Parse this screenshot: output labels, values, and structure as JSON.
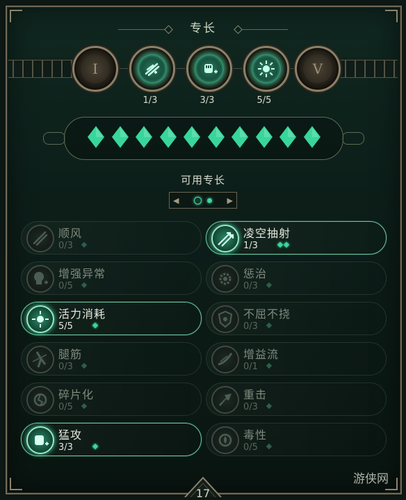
{
  "header": {
    "title": "专长"
  },
  "tiers": [
    {
      "id": "I",
      "label": "I",
      "locked": true,
      "icon": "locked-tier-icon",
      "count": ""
    },
    {
      "id": "II",
      "label": "",
      "locked": false,
      "icon": "wind-feathers-icon",
      "count": "1/3"
    },
    {
      "id": "III",
      "label": "",
      "locked": false,
      "icon": "fist-plus-icon",
      "count": "3/3"
    },
    {
      "id": "IV",
      "label": "",
      "locked": false,
      "icon": "sun-burst-icon",
      "count": "5/5"
    },
    {
      "id": "V",
      "label": "V",
      "locked": true,
      "icon": "locked-tier-icon",
      "count": ""
    }
  ],
  "points": {
    "filled": 10,
    "total": 10,
    "color": "#38d69c"
  },
  "available": {
    "label": "可用专长",
    "pager": {
      "left_arrow": "◀",
      "right_arrow": "▶",
      "page": 2,
      "pages": 2
    }
  },
  "skills_left": [
    {
      "name": "顺风",
      "rank": "0/3",
      "cost": 1,
      "active": false,
      "icon": "wind-feathers-icon"
    },
    {
      "name": "增强异常",
      "rank": "0/5",
      "cost": 1,
      "active": false,
      "icon": "skull-plus-icon"
    },
    {
      "name": "活力消耗",
      "rank": "5/5",
      "cost": 1,
      "active": true,
      "icon": "sun-burst-icon"
    },
    {
      "name": "腿筋",
      "rank": "0/3",
      "cost": 1,
      "active": false,
      "icon": "leg-slash-icon"
    },
    {
      "name": "碎片化",
      "rank": "0/5",
      "cost": 1,
      "active": false,
      "icon": "shatter-icon"
    },
    {
      "name": "猛攻",
      "rank": "3/3",
      "cost": 1,
      "active": true,
      "icon": "fist-plus-icon"
    }
  ],
  "skills_right": [
    {
      "name": "凌空抽射",
      "rank": "1/3",
      "cost": 2,
      "active": true,
      "icon": "arrow-volley-icon"
    },
    {
      "name": "惩治",
      "rank": "0/3",
      "cost": 1,
      "active": false,
      "icon": "gear-cross-icon"
    },
    {
      "name": "不屈不挠",
      "rank": "0/3",
      "cost": 1,
      "active": false,
      "icon": "shield-burst-icon"
    },
    {
      "name": "增益流",
      "rank": "0/1",
      "cost": 1,
      "active": false,
      "icon": "swoosh-icon"
    },
    {
      "name": "重击",
      "rank": "0/3",
      "cost": 1,
      "active": false,
      "icon": "impact-icon"
    },
    {
      "name": "毒性",
      "rank": "0/5",
      "cost": 1,
      "active": false,
      "icon": "poison-drop-icon"
    }
  ],
  "footer": {
    "level": "17"
  },
  "watermark": "游侠网"
}
